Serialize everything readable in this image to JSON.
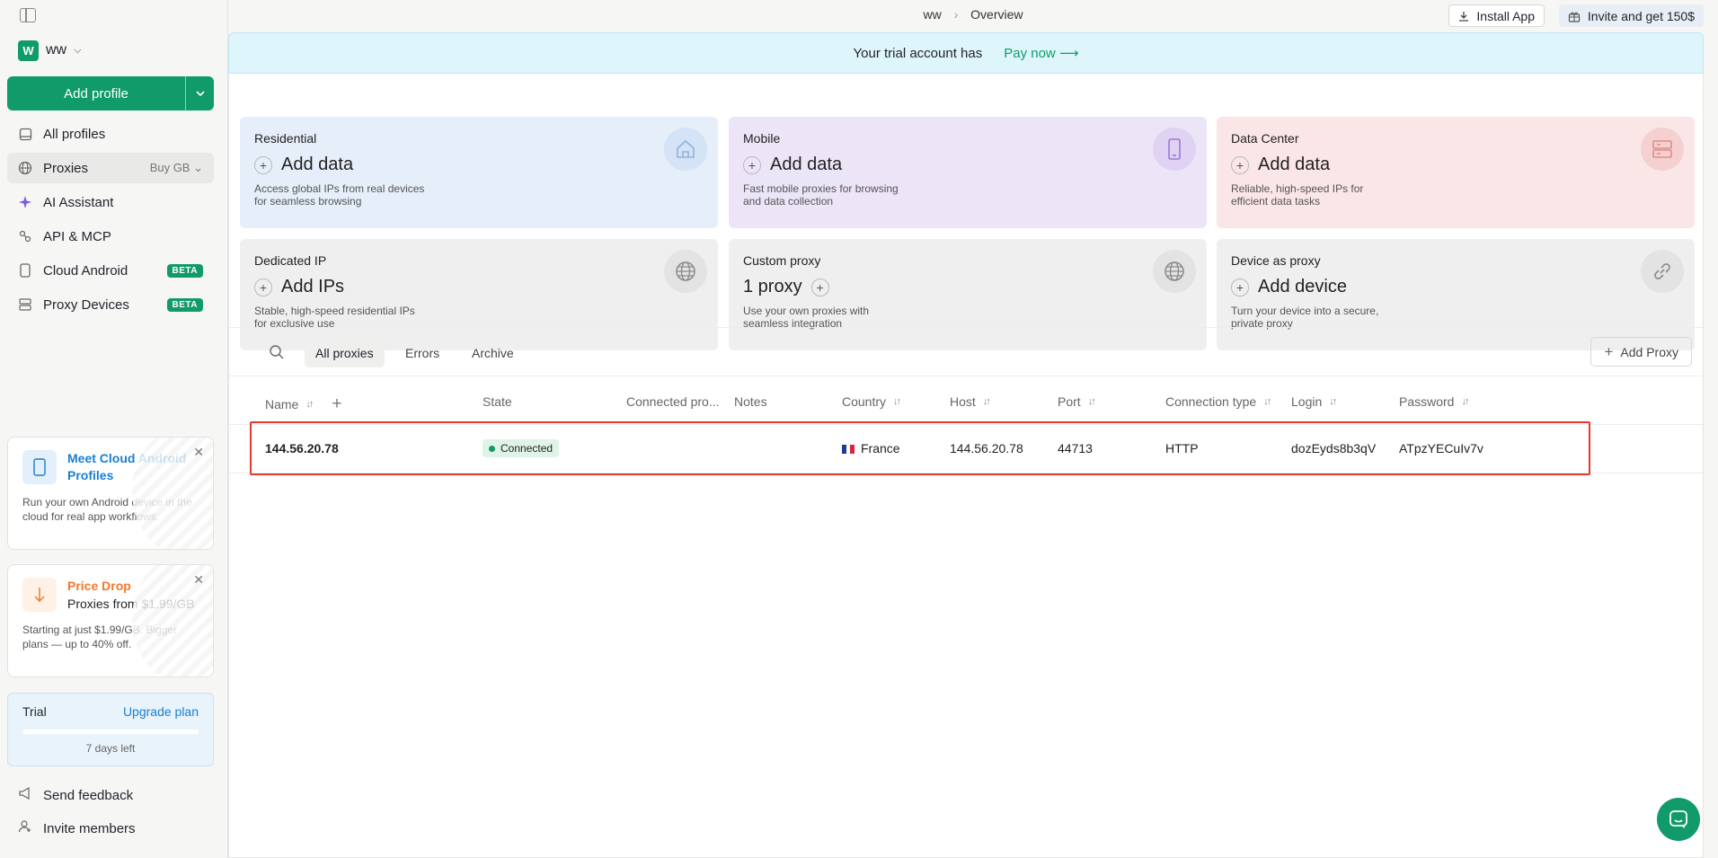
{
  "topbar": {
    "breadcrumb_workspace": "ww",
    "breadcrumb_page": "Overview",
    "install_label": "Install App",
    "invite_label": "Invite and get 150$"
  },
  "sidebar": {
    "workspace_initial": "W",
    "workspace_name": "ww",
    "add_profile_label": "Add profile",
    "items": [
      {
        "label": "All profiles",
        "icon": "profiles-icon"
      },
      {
        "label": "Proxies",
        "icon": "globe-icon",
        "extra": "Buy GB"
      },
      {
        "label": "AI Assistant",
        "icon": "sparkle-icon"
      },
      {
        "label": "API & MCP",
        "icon": "api-icon"
      },
      {
        "label": "Cloud Android",
        "icon": "phone-icon",
        "badge": "BETA"
      },
      {
        "label": "Proxy Devices",
        "icon": "server-icon",
        "badge": "BETA"
      }
    ],
    "promo_cloud": {
      "title": "Meet Cloud Android Profiles",
      "desc": "Run your own Android device in the cloud for real app workflows."
    },
    "promo_price": {
      "title": "Price Drop",
      "subtitle": "Proxies from $1.99/GB",
      "desc": "Starting at just $1.99/GB. Bigger plans — up to 40% off."
    },
    "trial": {
      "label": "Trial",
      "upgrade_label": "Upgrade plan",
      "days_left": "7 days left"
    },
    "send_feedback": "Send feedback",
    "invite_members": "Invite members"
  },
  "banner": {
    "text": "Your trial account has",
    "pay_label": "Pay now"
  },
  "cards": [
    {
      "title": "Residential",
      "action": "Add data",
      "desc": "Access global IPs from real devices for seamless browsing",
      "bg": "#e5eef9",
      "icon_bg": "#d4e3f5",
      "icon_color": "#8fb4de",
      "icon": "home-icon"
    },
    {
      "title": "Mobile",
      "action": "Add data",
      "desc": "Fast mobile proxies for browsing and data collection",
      "bg": "#ece5f8",
      "icon_bg": "#dfd2f3",
      "icon_color": "#9b78d6",
      "icon": "mobile-icon"
    },
    {
      "title": "Data Center",
      "action": "Add data",
      "desc": "Reliable, high-speed IPs for efficient data tasks",
      "bg": "#fae6e6",
      "icon_bg": "#f4d0d0",
      "icon_color": "#e08a8a",
      "icon": "server-icon"
    },
    {
      "title": "Dedicated IP",
      "action": "Add IPs",
      "desc": "Stable, high-speed residential IPs for exclusive use",
      "bg": "#efefef",
      "icon_bg": "#e3e3e3",
      "icon_color": "#8a8a8a",
      "icon": "globe-icon"
    },
    {
      "title": "Custom proxy",
      "action": "1 proxy",
      "desc": "Use your own proxies with seamless integration",
      "bg": "#efefef",
      "icon_bg": "#e3e3e3",
      "icon_color": "#8a8a8a",
      "icon": "globe-icon"
    },
    {
      "title": "Device as proxy",
      "action": "Add device",
      "desc": "Turn your device into a secure, private proxy",
      "bg": "#efefef",
      "icon_bg": "#e3e3e3",
      "icon_color": "#8a8a8a",
      "icon": "link-icon"
    }
  ],
  "filters": [
    "All proxies",
    "Errors",
    "Archive"
  ],
  "add_proxy_label": "Add Proxy",
  "table": {
    "headers": [
      "Name",
      "State",
      "Connected pro...",
      "Notes",
      "Country",
      "Host",
      "Port",
      "Connection type",
      "Login",
      "Password"
    ],
    "row": {
      "name": "144.56.20.78",
      "state": "Connected",
      "connected_profiles": "",
      "notes": "",
      "country": "France",
      "host": "144.56.20.78",
      "port": "44713",
      "connection_type": "HTTP",
      "login": "dozEyds8b3qV",
      "password": "ATpzYECuIv7v"
    }
  },
  "colors": {
    "accent": "#119a6a",
    "highlight": "#e43a2f",
    "link": "#1a7fd0",
    "orange": "#f07a2a"
  }
}
